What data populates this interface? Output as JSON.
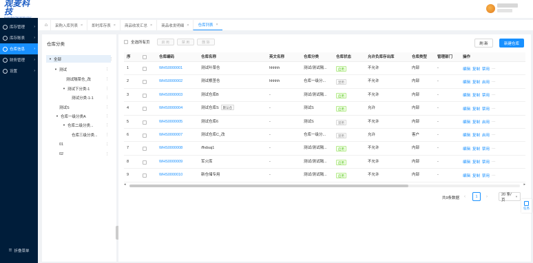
{
  "brand": {
    "name": "观麦科技",
    "sub": "GUANMAITECHNOLOGY"
  },
  "sidebar": {
    "items": [
      {
        "label": "库存管理",
        "active": false
      },
      {
        "label": "库存账表",
        "active": false
      },
      {
        "label": "仓库信息",
        "active": true
      },
      {
        "label": "财务管理",
        "active": false
      },
      {
        "label": "设置",
        "active": false
      }
    ],
    "collapse_label": "折叠菜单"
  },
  "tabs": [
    {
      "label": "采购入库列表",
      "active": false
    },
    {
      "label": "即时库存表",
      "active": false
    },
    {
      "label": "商品收发汇总",
      "active": false
    },
    {
      "label": "商品收发明细",
      "active": false
    },
    {
      "label": "仓库列表",
      "active": true
    }
  ],
  "tree": {
    "title": "仓库分类",
    "nodes": [
      {
        "label": "全部",
        "selected": true,
        "caret": true
      },
      {
        "label": "测试",
        "selected": false,
        "caret": true
      },
      {
        "label": "测试隔菜仓_改",
        "selected": false,
        "caret": false
      },
      {
        "label": "测试下分类-1",
        "selected": false,
        "caret": true
      },
      {
        "label": "测试分类-1-1",
        "selected": false,
        "caret": false
      },
      {
        "label": "测试S",
        "selected": false,
        "caret": false
      },
      {
        "label": "仓库一级分类A",
        "selected": false,
        "caret": true
      },
      {
        "label": "仓库二级分类...",
        "selected": false,
        "caret": true
      },
      {
        "label": "仓库三级分类...",
        "selected": false,
        "caret": false
      },
      {
        "label": "01",
        "selected": false,
        "caret": false
      },
      {
        "label": "02",
        "selected": false,
        "caret": false
      }
    ]
  },
  "toolbar": {
    "select_all_label": "全选所有页",
    "batch_buttons": [
      "启 用",
      "禁 用",
      "删 除"
    ],
    "refresh_label": "刷 新",
    "new_label": "新建仓库"
  },
  "table": {
    "columns": [
      "序",
      "仓库编码",
      "仓库名称",
      "英文名称",
      "仓库分类",
      "仓库状态",
      "允许负库存出库",
      "仓库类型",
      "管理部门",
      "操作"
    ],
    "rows": [
      {
        "idx": "1",
        "code": "WHS0000001",
        "name": "测试叶菜仓",
        "tag": "",
        "en": "hhhhh",
        "category": "测试/测试隔...",
        "status": "启用",
        "enabled": true,
        "negative": "不允许",
        "type": "内部",
        "dept": "-",
        "toggle": "禁用"
      },
      {
        "idx": "2",
        "code": "WHS0000002",
        "name": "测试根茎仓",
        "tag": "",
        "en": "hhhhh",
        "category": "仓库一级分...",
        "status": "禁用",
        "enabled": false,
        "negative": "不允许",
        "type": "内部",
        "dept": "-",
        "toggle": "启用"
      },
      {
        "idx": "3",
        "code": "WHS0000003",
        "name": "测试仓库B",
        "tag": "",
        "en": "-",
        "category": "测试/测试隔...",
        "status": "启用",
        "enabled": true,
        "negative": "不允许",
        "type": "内部",
        "dept": "-",
        "toggle": "禁用"
      },
      {
        "idx": "4",
        "code": "WHS0000004",
        "name": "测试仓库S",
        "tag": "默认仓",
        "en": "-",
        "category": "测试S",
        "status": "启用",
        "enabled": true,
        "negative": "允许",
        "type": "内部",
        "dept": "-",
        "toggle": "禁用"
      },
      {
        "idx": "5",
        "code": "WHS0000005",
        "name": "测试仓库6",
        "tag": "",
        "en": "-",
        "category": "测试S",
        "status": "禁用",
        "enabled": false,
        "negative": "不允许",
        "type": "内部",
        "dept": "-",
        "toggle": "启用"
      },
      {
        "idx": "6",
        "code": "WHS0000007",
        "name": "测试仓库C_改",
        "tag": "",
        "en": "-",
        "category": "仓库一级分...",
        "status": "禁用",
        "enabled": false,
        "negative": "允许",
        "type": "客户",
        "dept": "-",
        "toggle": "启用"
      },
      {
        "idx": "7",
        "code": "WHS0000008",
        "name": "/fhdsaj1",
        "tag": "",
        "en": "-",
        "category": "测试/测试隔...",
        "status": "启用",
        "enabled": true,
        "negative": "不允许",
        "type": "内部",
        "dept": "-",
        "toggle": "禁用"
      },
      {
        "idx": "8",
        "code": "WHS0000009",
        "name": "军火库",
        "tag": "",
        "en": "-",
        "category": "测试/测试隔...",
        "status": "启用",
        "enabled": true,
        "negative": "不允许",
        "type": "内部",
        "dept": "-",
        "toggle": "禁用"
      },
      {
        "idx": "9",
        "code": "WHS0000010",
        "name": "新仓储专用",
        "tag": "",
        "en": "-",
        "category": "测试/测试隔...",
        "status": "启用",
        "enabled": true,
        "negative": "不允许",
        "type": "内部",
        "dept": "-",
        "toggle": "禁用"
      }
    ],
    "op_edit": "编辑",
    "op_copy": "复制",
    "op_more": "···"
  },
  "pagination": {
    "total": "共9条数据",
    "current": "1",
    "page_size": "20 条/页"
  },
  "float_task": "任务"
}
